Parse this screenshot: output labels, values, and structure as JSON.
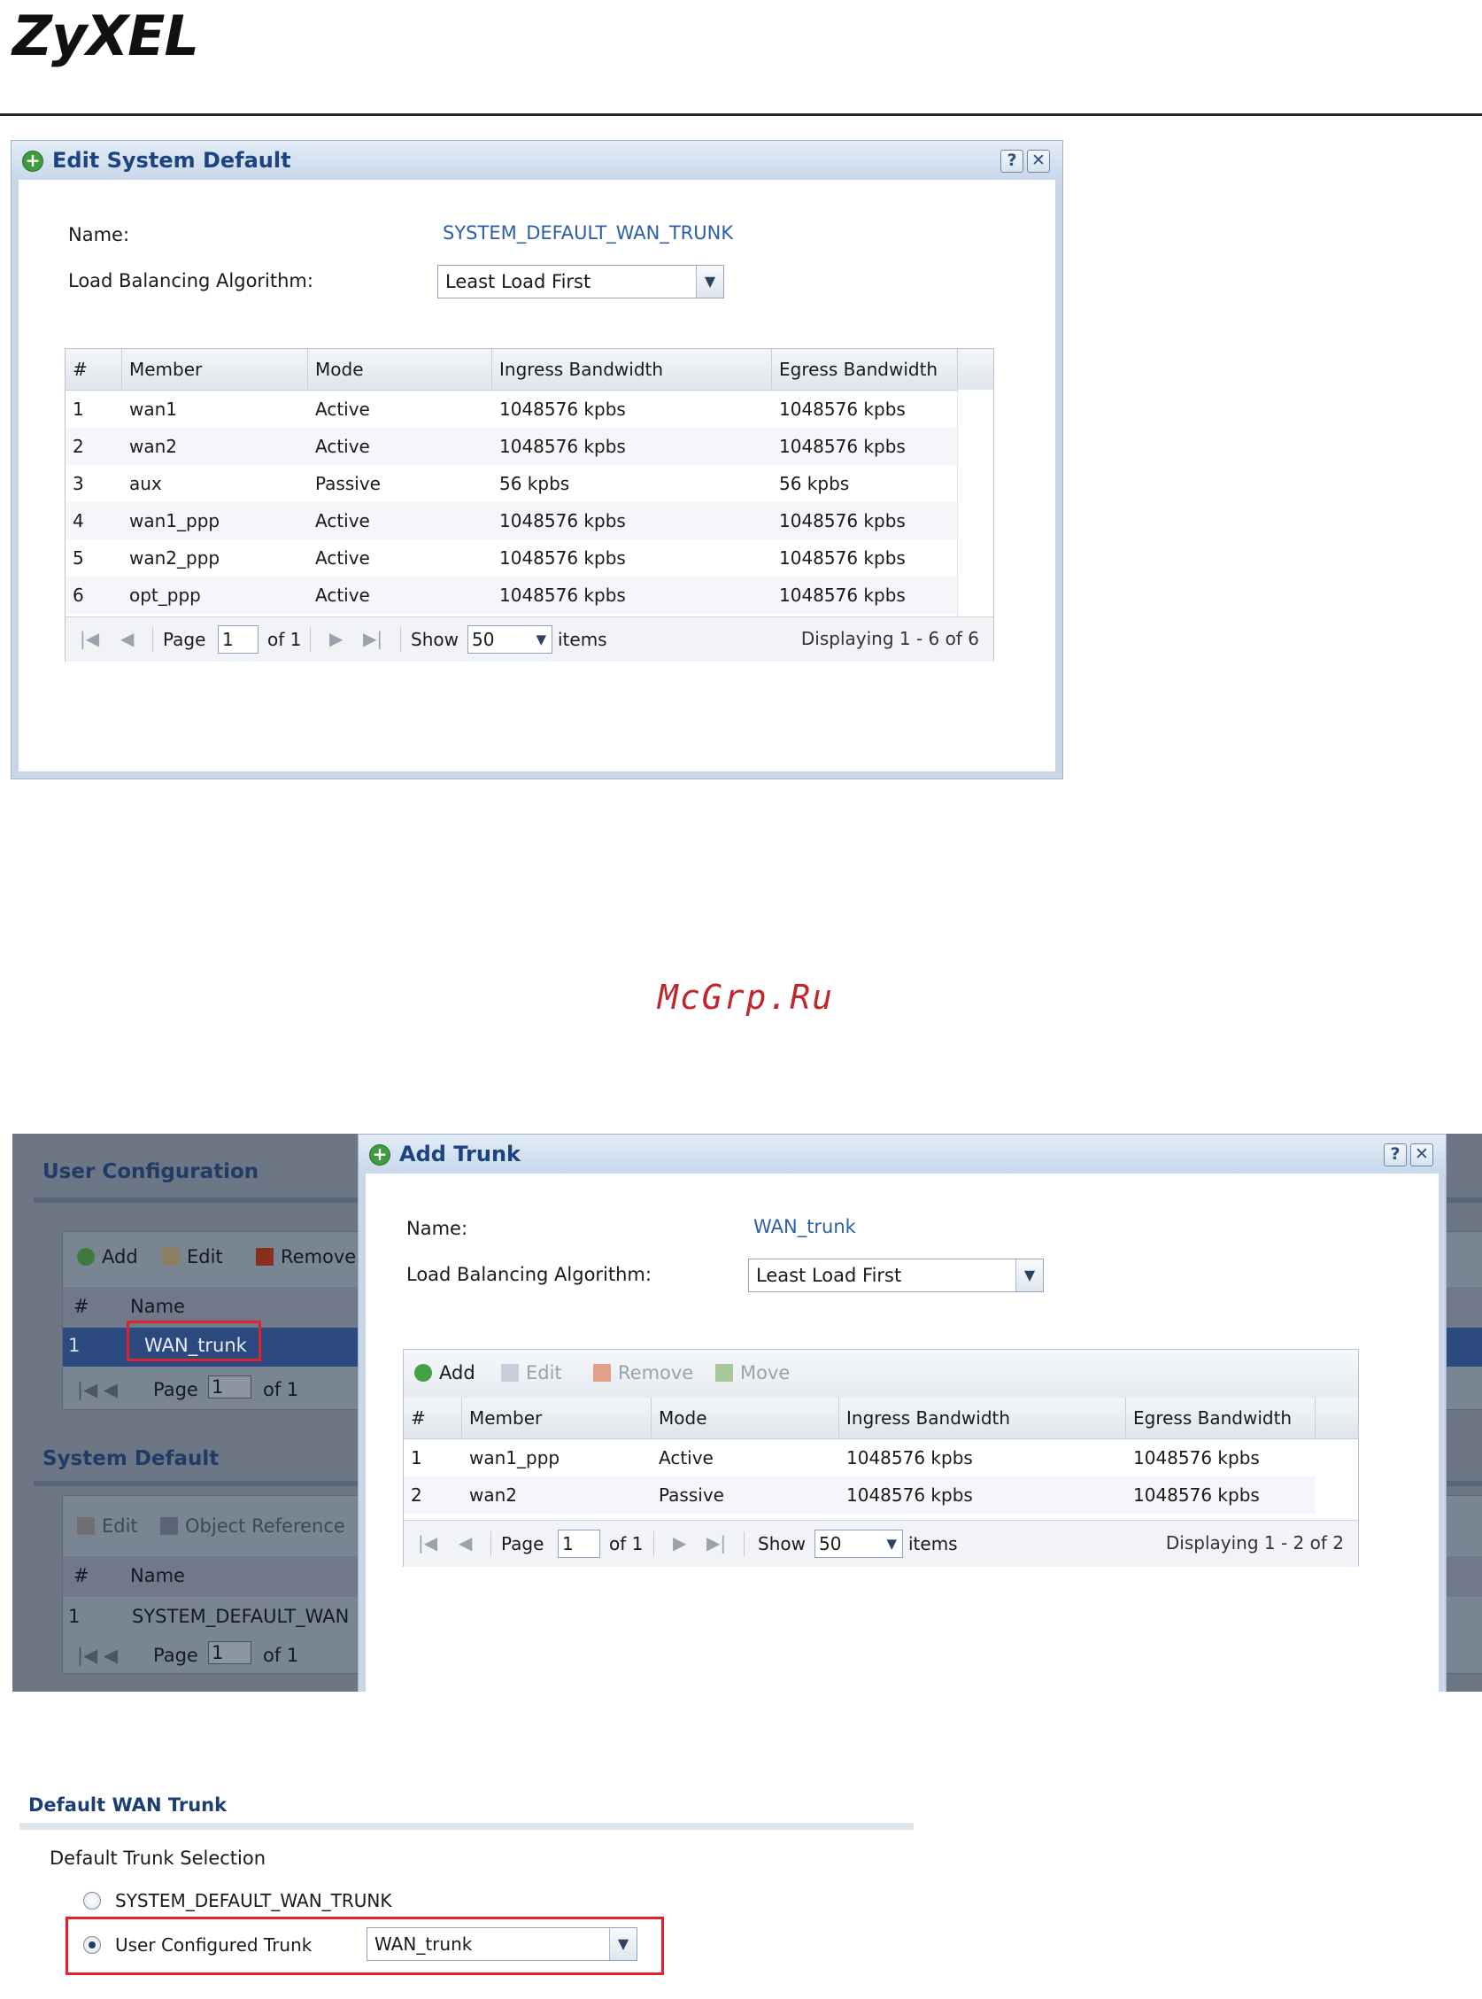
{
  "brand": {
    "logo": "ZyXEL"
  },
  "watermark": "McGrp.Ru",
  "edit_dialog": {
    "title": "Edit System Default",
    "name_label": "Name:",
    "name_value": "SYSTEM_DEFAULT_WAN_TRUNK",
    "algo_label": "Load Balancing Algorithm:",
    "algo_value": "Least Load First",
    "columns": [
      "#",
      "Member",
      "Mode",
      "Ingress Bandwidth",
      "Egress Bandwidth"
    ],
    "rows": [
      [
        "1",
        "wan1",
        "Active",
        "1048576 kpbs",
        "1048576 kpbs"
      ],
      [
        "2",
        "wan2",
        "Active",
        "1048576 kpbs",
        "1048576 kpbs"
      ],
      [
        "3",
        "aux",
        "Passive",
        "56 kpbs",
        "56 kpbs"
      ],
      [
        "4",
        "wan1_ppp",
        "Active",
        "1048576 kpbs",
        "1048576 kpbs"
      ],
      [
        "5",
        "wan2_ppp",
        "Active",
        "1048576 kpbs",
        "1048576 kpbs"
      ],
      [
        "6",
        "opt_ppp",
        "Active",
        "1048576 kpbs",
        "1048576 kpbs"
      ]
    ],
    "pager": {
      "page_label": "Page",
      "page_value": "1",
      "of": "of 1",
      "show_label": "Show",
      "show_value": "50",
      "items_label": "items",
      "display": "Displaying 1 - 6 of 6"
    }
  },
  "background_page": {
    "user_config_title": "User Configuration",
    "toolbar": {
      "add": "Add",
      "edit": "Edit",
      "remove": "Remove"
    },
    "columns": [
      "#",
      "Name"
    ],
    "user_rows": [
      [
        "1",
        "WAN_trunk"
      ]
    ],
    "pager": {
      "page_label": "Page",
      "page_value": "1",
      "of": "of 1"
    },
    "system_default_title": "System Default",
    "sys_toolbar": {
      "edit": "Edit",
      "object_reference": "Object Reference"
    },
    "sys_rows": [
      [
        "1",
        "SYSTEM_DEFAULT_WAN"
      ]
    ]
  },
  "add_dialog": {
    "title": "Add Trunk",
    "name_label": "Name:",
    "name_value": "WAN_trunk",
    "algo_label": "Load Balancing Algorithm:",
    "algo_value": "Least Load First",
    "toolbar": {
      "add": "Add",
      "edit": "Edit",
      "remove": "Remove",
      "move": "Move"
    },
    "columns": [
      "#",
      "Member",
      "Mode",
      "Ingress Bandwidth",
      "Egress Bandwidth"
    ],
    "rows": [
      [
        "1",
        "wan1_ppp",
        "Active",
        "1048576 kpbs",
        "1048576 kpbs"
      ],
      [
        "2",
        "wan2",
        "Passive",
        "1048576 kpbs",
        "1048576 kpbs"
      ]
    ],
    "pager": {
      "page_label": "Page",
      "page_value": "1",
      "of": "of 1",
      "show_label": "Show",
      "show_value": "50",
      "items_label": "items",
      "display": "Displaying 1 - 2 of 2"
    }
  },
  "default_wan_trunk": {
    "title": "Default WAN Trunk",
    "selection_label": "Default Trunk Selection",
    "option_system": "SYSTEM_DEFAULT_WAN_TRUNK",
    "option_user": "User Configured Trunk",
    "user_trunk_value": "WAN_trunk",
    "selected": "user"
  }
}
